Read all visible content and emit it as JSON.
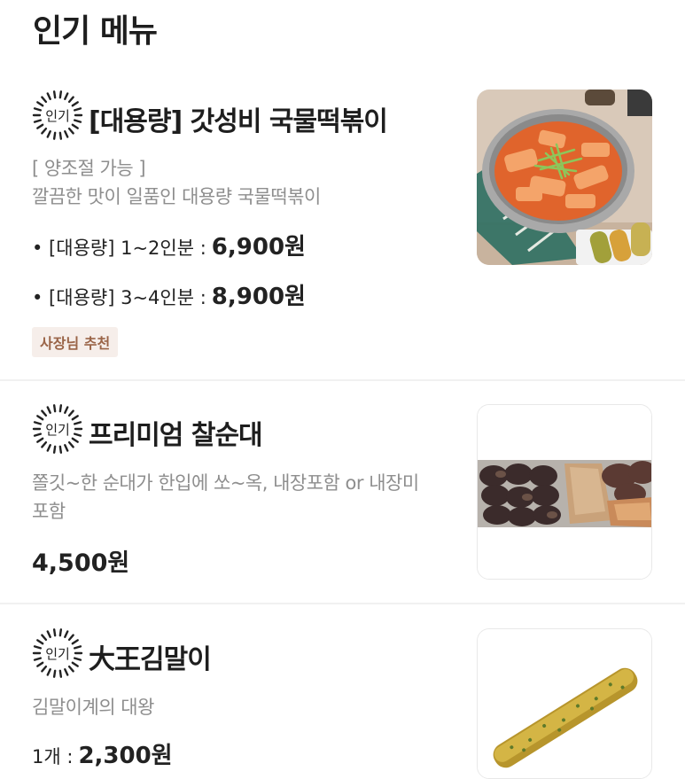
{
  "section_title": "인기 메뉴",
  "badge_text": "인기",
  "items": [
    {
      "name": "[대용량] 갓성비 국물떡볶이",
      "option_note": "[ 양조절 가능 ]",
      "description": "깔끔한 맛이 일품인 대용량 국물떡볶이",
      "prices": [
        {
          "label": "• [대용량] 1~2인분 :",
          "amount": "6,900원"
        },
        {
          "label": "• [대용량] 3~4인분 :",
          "amount": "8,900원"
        }
      ],
      "tag": "사장님 추천",
      "image_icon": "tteokbokki-photo"
    },
    {
      "name": "프리미엄 찰순대",
      "description_line1": "쫄깃~한 순대가 한입에 쏘~옥, 내장포함 or 내장미",
      "description_line2": "포함",
      "price": "4,500원",
      "image_icon": "sundae-photo"
    },
    {
      "name": "大王김말이",
      "description": "김말이계의 대왕",
      "price_label": "1개 :",
      "price_amount": "2,300원",
      "image_icon": "gimmari-photo"
    }
  ],
  "colors": {
    "tag_bg": "#f6eeea",
    "tag_text": "#9a6447",
    "divider": "#f1f1f1"
  }
}
